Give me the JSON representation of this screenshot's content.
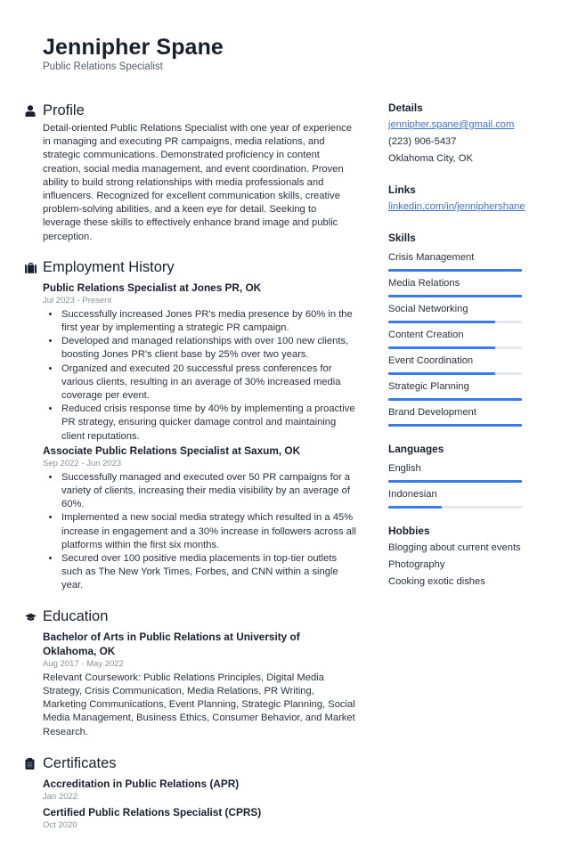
{
  "header": {
    "name": "Jennipher Spane",
    "title": "Public Relations Specialist"
  },
  "profile": {
    "heading": "Profile",
    "icon": "user-icon",
    "text": "Detail-oriented Public Relations Specialist with one year of experience in managing and executing PR campaigns, media relations, and strategic communications. Demonstrated proficiency in content creation, social media management, and event coordination. Proven ability to build strong relationships with media professionals and influencers. Recognized for excellent communication skills, creative problem-solving abilities, and a keen eye for detail. Seeking to leverage these skills to effectively enhance brand image and public perception."
  },
  "employment": {
    "heading": "Employment History",
    "icon": "briefcase-icon",
    "jobs": [
      {
        "title": "Public Relations Specialist at Jones PR, OK",
        "date": "Jul 2023 - Present",
        "bullets": [
          "Successfully increased Jones PR's media presence by 60% in the first year by implementing a strategic PR campaign.",
          "Developed and managed relationships with over 100 new clients, boosting Jones PR's client base by 25% over two years.",
          "Organized and executed 20 successful press conferences for various clients, resulting in an average of 30% increased media coverage per event.",
          "Reduced crisis response time by 40% by implementing a proactive PR strategy, ensuring quicker damage control and maintaining client reputations."
        ]
      },
      {
        "title": "Associate Public Relations Specialist at Saxum, OK",
        "date": "Sep 2022 - Jun 2023",
        "bullets": [
          "Successfully managed and executed over 50 PR campaigns for a variety of clients, increasing their media visibility by an average of 60%.",
          "Implemented a new social media strategy which resulted in a 45% increase in engagement and a 30% increase in followers across all platforms within the first six months.",
          "Secured over 100 positive media placements in top-tier outlets such as The New York Times, Forbes, and CNN within a single year."
        ]
      }
    ]
  },
  "education": {
    "heading": "Education",
    "icon": "graduation-cap-icon",
    "entries": [
      {
        "title": "Bachelor of Arts in Public Relations at University of Oklahoma, OK",
        "date": "Aug 2017 - May 2022",
        "description": "Relevant Coursework: Public Relations Principles, Digital Media Strategy, Crisis Communication, Media Relations, PR Writing, Marketing Communications, Event Planning, Strategic Planning, Social Media Management, Business Ethics, Consumer Behavior, and Market Research."
      }
    ]
  },
  "certificates": {
    "heading": "Certificates",
    "icon": "clipboard-icon",
    "entries": [
      {
        "title": "Accreditation in Public Relations (APR)",
        "date": "Jan 2022"
      },
      {
        "title": "Certified Public Relations Specialist (CPRS)",
        "date": "Oct 2020"
      }
    ]
  },
  "details": {
    "heading": "Details",
    "email": "jennipher.spane@gmail.com",
    "phone": "(223) 906-5437",
    "location": "Oklahoma City, OK"
  },
  "links": {
    "heading": "Links",
    "items": [
      "linkedin.com/in/jenniphershane"
    ]
  },
  "skills": {
    "heading": "Skills",
    "items": [
      {
        "label": "Crisis Management",
        "level": 100
      },
      {
        "label": "Media Relations",
        "level": 100
      },
      {
        "label": "Social Networking",
        "level": 80
      },
      {
        "label": "Content Creation",
        "level": 80
      },
      {
        "label": "Event Coordination",
        "level": 80
      },
      {
        "label": "Strategic Planning",
        "level": 100
      },
      {
        "label": "Brand Development",
        "level": 100
      }
    ]
  },
  "languages": {
    "heading": "Languages",
    "items": [
      {
        "label": "English",
        "level": 100
      },
      {
        "label": "Indonesian",
        "level": 40
      }
    ]
  },
  "hobbies": {
    "heading": "Hobbies",
    "items": [
      "Blogging about current events",
      "Photography",
      "Cooking exotic dishes"
    ]
  },
  "colors": {
    "accent": "#3a7bec",
    "link": "#3b73d9",
    "track": "#e4e6ea",
    "text": "#1a1f2e"
  }
}
